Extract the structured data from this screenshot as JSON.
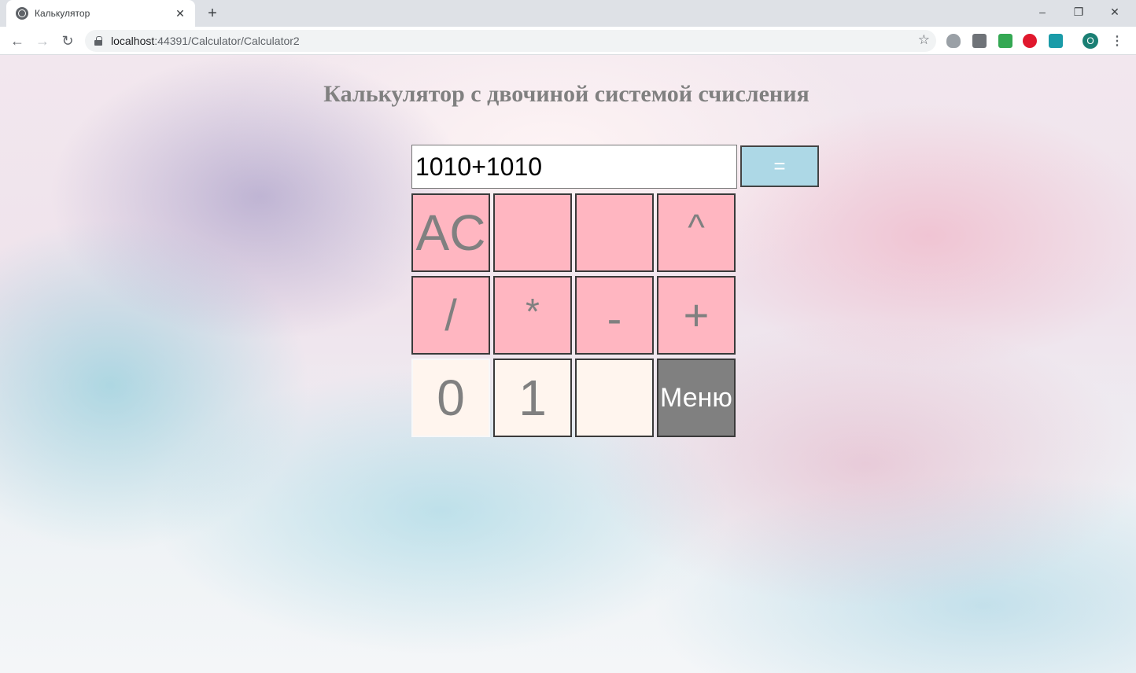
{
  "browser": {
    "tab_title": "Калькулятор",
    "tab_close": "✕",
    "new_tab": "+",
    "window_controls": {
      "minimize": "–",
      "maximize": "❐",
      "close": "✕"
    },
    "url_host": "localhost",
    "url_path": ":44391/Calculator/Calculator2",
    "avatar_letter": "O"
  },
  "page": {
    "title": "Калькулятор с двочиной системой счисления"
  },
  "calculator": {
    "display_value": "1010+1010",
    "equals_label": "=",
    "keys": {
      "ac": "AC",
      "blank1": "",
      "blank2": "",
      "power": "^",
      "divide": "/",
      "multiply": "*",
      "minus": "-",
      "plus": "+",
      "zero": "0",
      "one": "1",
      "blank3": "",
      "menu": "Меню"
    }
  },
  "colors": {
    "operator_key": "#ffb6c1",
    "digit_key": "#fff5ee",
    "menu_key": "#808080",
    "equals_key": "#add8e6",
    "title": "#808080"
  }
}
